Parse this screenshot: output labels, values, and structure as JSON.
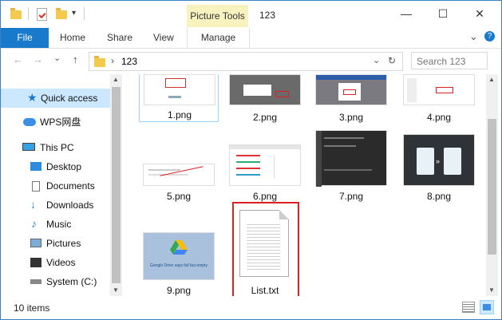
{
  "window": {
    "title": "123"
  },
  "titlebar": {
    "context_tab": "Picture Tools",
    "minimize_glyph": "—",
    "maximize_glyph": "☐",
    "close_glyph": "✕"
  },
  "ribbon": {
    "tabs": [
      {
        "label": "File"
      },
      {
        "label": "Home"
      },
      {
        "label": "Share"
      },
      {
        "label": "View"
      }
    ],
    "context_tab": "Manage",
    "collapse_glyph": "⌄",
    "help_glyph": "?"
  },
  "address": {
    "back_glyph": "←",
    "forward_glyph": "→",
    "recent_glyph": "⌄",
    "up_glyph": "↑",
    "chevron": "›",
    "path": "123",
    "dropdown_glyph": "⌄",
    "refresh_glyph": "↻",
    "search_placeholder": "Search 123"
  },
  "sidebar": {
    "items": [
      {
        "label": "Quick access",
        "icon": "star-icon"
      },
      {
        "label": "WPS网盘",
        "icon": "cloud-icon"
      },
      {
        "label": "This PC",
        "icon": "computer-icon"
      },
      {
        "label": "Desktop",
        "icon": "desktop-icon"
      },
      {
        "label": "Documents",
        "icon": "documents-icon"
      },
      {
        "label": "Downloads",
        "icon": "downloads-icon"
      },
      {
        "label": "Music",
        "icon": "music-icon"
      },
      {
        "label": "Pictures",
        "icon": "pictures-icon"
      },
      {
        "label": "Videos",
        "icon": "videos-icon"
      },
      {
        "label": "System (C:)",
        "icon": "drive-icon"
      }
    ]
  },
  "files": [
    {
      "name": "1.png"
    },
    {
      "name": "2.png"
    },
    {
      "name": "3.png"
    },
    {
      "name": "4.png"
    },
    {
      "name": "5.png"
    },
    {
      "name": "6.png"
    },
    {
      "name": "7.png"
    },
    {
      "name": "8.png"
    },
    {
      "name": "9.png",
      "caption": "Google Drive says full but empty"
    },
    {
      "name": "List.txt"
    }
  ],
  "status": {
    "count": "10 items"
  },
  "colors": {
    "accent": "#1979ca",
    "selection": "#cce8ff",
    "highlight": "#e02020",
    "context_tab": "#f7f2be"
  }
}
